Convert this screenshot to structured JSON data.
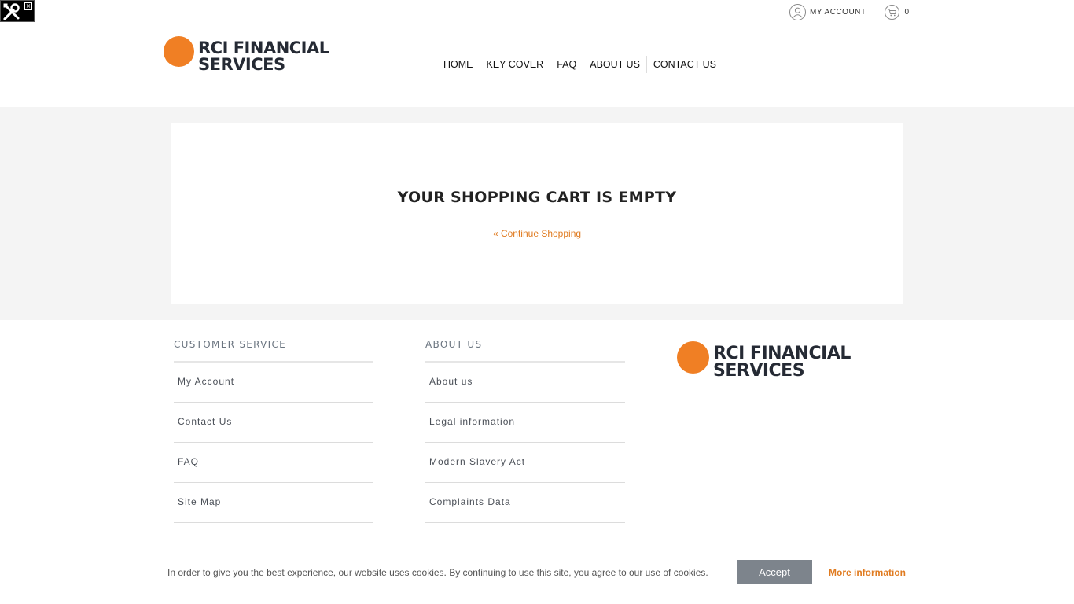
{
  "devtools": {
    "icon": "wrench-screwdriver-icon",
    "close": "×"
  },
  "topbar": {
    "account_label": "MY ACCOUNT",
    "account_icon": "user-icon",
    "cart_icon": "cart-icon",
    "cart_count": "0"
  },
  "brand": {
    "line1": "RCI FINANCIAL",
    "line2": "SERVICES",
    "color": "#f07f24"
  },
  "nav": {
    "items": [
      {
        "label": "HOME"
      },
      {
        "label": "KEY COVER"
      },
      {
        "label": "FAQ"
      },
      {
        "label": "ABOUT US"
      },
      {
        "label": "CONTACT US"
      }
    ]
  },
  "cart": {
    "title": "YOUR SHOPPING CART IS EMPTY",
    "continue_label": "« Continue Shopping"
  },
  "footer": {
    "customer_service": {
      "heading": "CUSTOMER SERVICE",
      "links": [
        "My Account",
        "Contact Us",
        "FAQ",
        "Site Map"
      ]
    },
    "about_us": {
      "heading": "ABOUT US",
      "links": [
        "About us",
        "Legal information",
        "Modern Slavery Act",
        "Complaints Data"
      ]
    }
  },
  "cookie": {
    "message": "In order to give you the best experience, our website uses cookies. By continuing to use this site, you agree to our use of cookies.",
    "accept_label": "Accept",
    "more_label": "More information"
  }
}
